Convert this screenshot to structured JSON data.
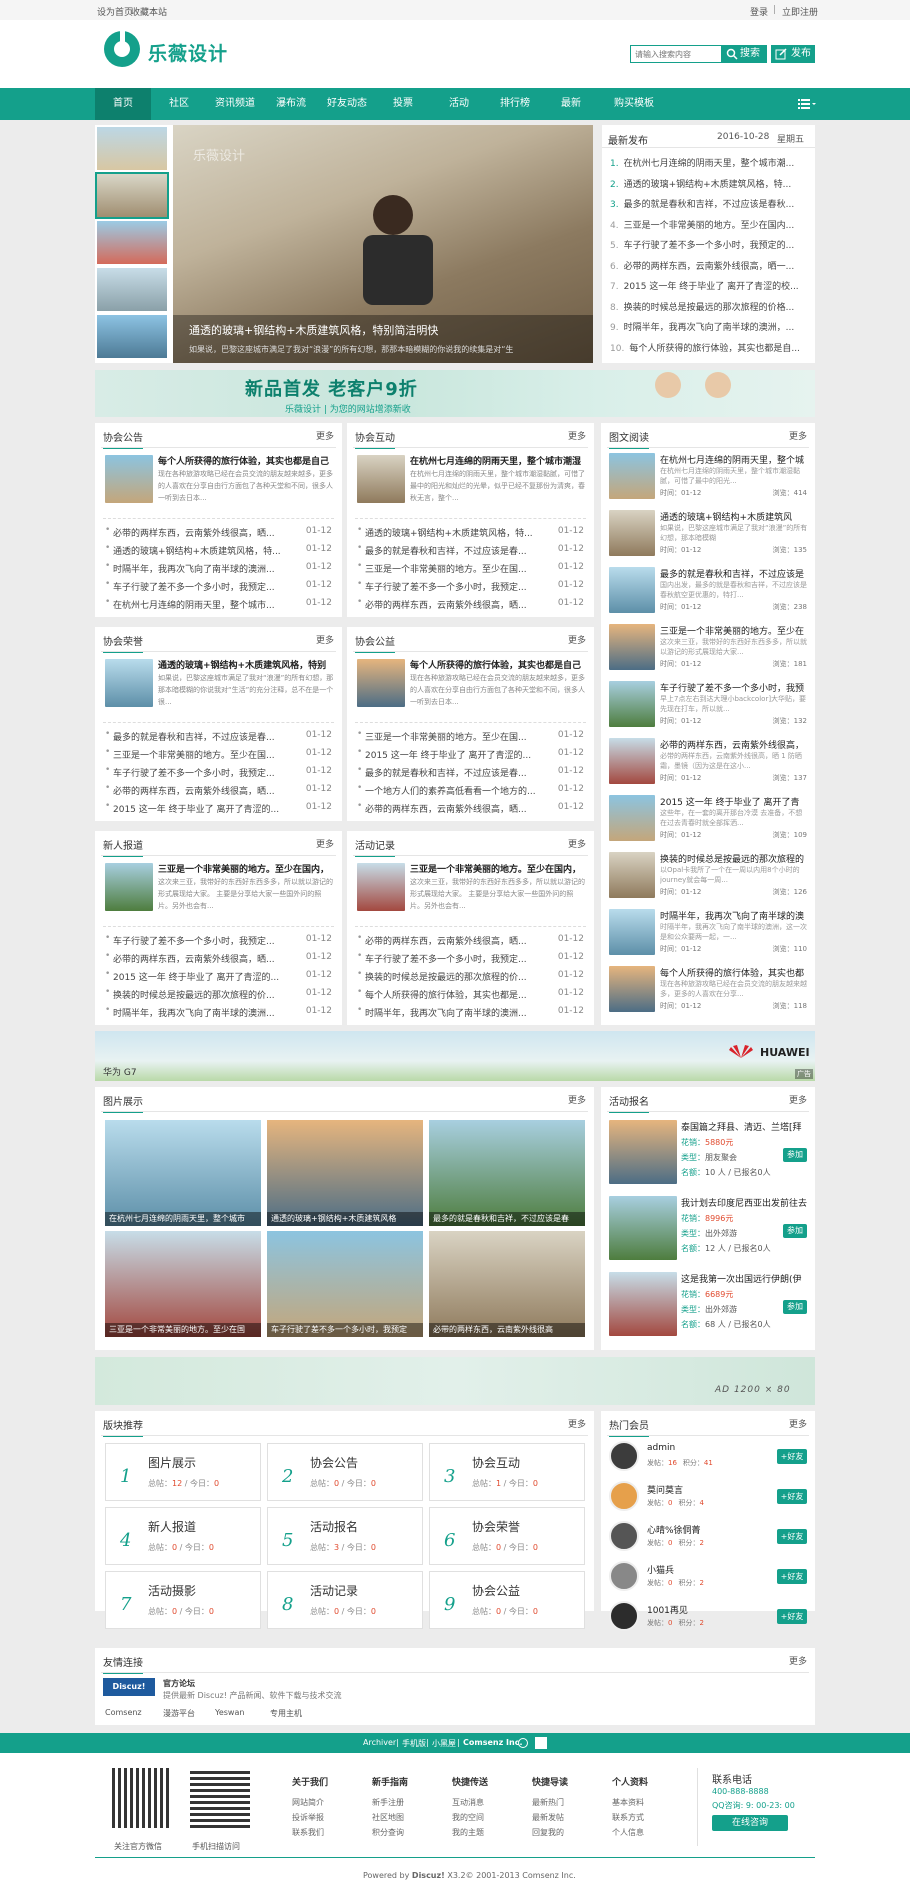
{
  "topbar": {
    "set_home": "设为首页",
    "bookmark": "收藏本站",
    "login": "登录",
    "register": "立即注册"
  },
  "header": {
    "logo_text": "乐薇设计",
    "search_placeholder": "请输入搜索内容",
    "search_btn": "搜索",
    "post_btn": "发布"
  },
  "nav": [
    "首页",
    "社区",
    "资讯频道",
    "瀑布流",
    "好友动态",
    "投票",
    "活动",
    "排行榜",
    "最新",
    "购买模板"
  ],
  "slider": {
    "caption_title": "通透的玻璃+钢结构+木质建筑风格，特别简洁明快",
    "caption_desc": "如果说，巴黎这座城市满足了我对“浪漫”的所有幻想，那那本暗模糊的你说我的续集是对“生",
    "watermark": "乐薇设计"
  },
  "latest": {
    "title": "最新发布",
    "date": "2016-10-28",
    "weekday": "星期五",
    "items": [
      {
        "n": "1.",
        "t": "在杭州七月连绵的阴雨天里，整个城市潮..."
      },
      {
        "n": "2.",
        "t": "通透的玻璃+钢结构+木质建筑风格，特..."
      },
      {
        "n": "3.",
        "t": "最多的就是春秋和吉祥，不过应该是春秋..."
      },
      {
        "n": "4.",
        "t": "三亚是一个非常美丽的地方。至少在国内..."
      },
      {
        "n": "5.",
        "t": "车子行驶了差不多一个多小时，我预定的..."
      },
      {
        "n": "6.",
        "t": "必带的两样东西，云南紫外线很高，晒一..."
      },
      {
        "n": "7.",
        "t": "2015 这一年 终于毕业了 离开了青涩的校..."
      },
      {
        "n": "8.",
        "t": "换装的时候总是按最远的那次旅程的价格..."
      },
      {
        "n": "9.",
        "t": "时隔半年，我再次飞向了南半球的澳洲，..."
      },
      {
        "n": "10.",
        "t": "每个人所获得的旅行体验，其实也都是自..."
      }
    ]
  },
  "banner1": {
    "title": "新品首发 老客户9折",
    "sub": "乐薇设计 | 为您的网站增添新收"
  },
  "forums": [
    {
      "title": "协会公告",
      "more": "更多",
      "feat_title": "每个人所获得的旅行体验，其实也都是自己",
      "feat_desc": "现在各种旅游攻略已经在会员交流的朋友越来越多，更多的人喜欢在分享自由行方面包了各种天堂和不同，很多人一听到去日本...",
      "items": [
        {
          "t": "必带的两样东西，云南紫外线很高，晒...",
          "d": "01-12"
        },
        {
          "t": "通透的玻璃+钢结构+木质建筑风格，特...",
          "d": "01-12"
        },
        {
          "t": "时隔半年，我再次飞向了南半球的澳洲...",
          "d": "01-12"
        },
        {
          "t": "车子行驶了差不多一个多小时，我预定...",
          "d": "01-12"
        },
        {
          "t": "在杭州七月连绵的阴雨天里，整个城市...",
          "d": "01-12"
        }
      ]
    },
    {
      "title": "协会互动",
      "more": "更多",
      "feat_title": "在杭州七月连绵的阴雨天里，整个城市潮湿",
      "feat_desc": "在杭州七月连绵的阴雨天里，整个城市潮湿黏腻，可惜了最中的阳光和灿烂的光晕，似乎已经不复那份为清爽，春秋无言，整个...",
      "items": [
        {
          "t": "通透的玻璃+钢结构+木质建筑风格，特...",
          "d": "01-12"
        },
        {
          "t": "最多的就是春秋和吉祥，不过应该是春...",
          "d": "01-12"
        },
        {
          "t": "三亚是一个非常美丽的地方。至少在国...",
          "d": "01-12"
        },
        {
          "t": "车子行驶了差不多一个多小时，我预定...",
          "d": "01-12"
        },
        {
          "t": "必带的两样东西，云南紫外线很高，晒...",
          "d": "01-12"
        }
      ]
    },
    {
      "title": "协会荣誉",
      "more": "更多",
      "feat_title": "通透的玻璃+钢结构+木质建筑风格，特别",
      "feat_desc": "如果说，巴黎这座城市满足了我对“浪漫”的所有幻想，那那本暗模糊的你说我对“生活”的充分注释，总不在是一个很...",
      "items": [
        {
          "t": "最多的就是春秋和吉祥，不过应该是春...",
          "d": "01-12"
        },
        {
          "t": "三亚是一个非常美丽的地方。至少在国...",
          "d": "01-12"
        },
        {
          "t": "车子行驶了差不多一个多小时，我预定...",
          "d": "01-12"
        },
        {
          "t": "必带的两样东西，云南紫外线很高，晒...",
          "d": "01-12"
        },
        {
          "t": "2015 这一年 终于毕业了 离开了青涩的...",
          "d": "01-12"
        }
      ]
    },
    {
      "title": "协会公益",
      "more": "更多",
      "feat_title": "每个人所获得的旅行体验，其实也都是自己",
      "feat_desc": "现在各种旅游攻略已经在会员交流的朋友越来越多，更多的人喜欢在分享自由行方面包了各种天堂和不同，很多人一听到去日本...",
      "items": [
        {
          "t": "三亚是一个非常美丽的地方。至少在国...",
          "d": "01-12"
        },
        {
          "t": "2015 这一年 终于毕业了 离开了青涩的...",
          "d": "01-12"
        },
        {
          "t": "最多的就是春秋和吉祥，不过应该是春...",
          "d": "01-12"
        },
        {
          "t": "一个地方人们的素养高低看看一个地方的...",
          "d": "01-12"
        },
        {
          "t": "必带的两样东西，云南紫外线很高，晒...",
          "d": "01-12"
        }
      ]
    },
    {
      "title": "新人报道",
      "more": "更多",
      "feat_title": "三亚是一个非常美丽的地方。至少在国内，",
      "feat_desc": "这次来三亚，我带好的东西好东西多多，所以就以游记的形式展现给大家。 主要是分享给大家一些国外问的照片。另外也会有...",
      "items": [
        {
          "t": "车子行驶了差不多一个多小时，我预定...",
          "d": "01-12"
        },
        {
          "t": "必带的两样东西，云南紫外线很高，晒...",
          "d": "01-12"
        },
        {
          "t": "2015 这一年 终于毕业了 离开了青涩的...",
          "d": "01-12"
        },
        {
          "t": "换装的时候总是按最远的那次旅程的价...",
          "d": "01-12"
        },
        {
          "t": "时隔半年，我再次飞向了南半球的澳洲...",
          "d": "01-12"
        }
      ]
    },
    {
      "title": "活动记录",
      "more": "更多",
      "feat_title": "三亚是一个非常美丽的地方。至少在国内，",
      "feat_desc": "这次来三亚，我带好的东西好东西多多，所以就以游记的形式展现给大家。 主要是分享给大家一些国外问的照片。另外也会有...",
      "items": [
        {
          "t": "必带的两样东西，云南紫外线很高，晒...",
          "d": "01-12"
        },
        {
          "t": "车子行驶了差不多一个多小时，我预定...",
          "d": "01-12"
        },
        {
          "t": "换装的时候总是按最远的那次旅程的价...",
          "d": "01-12"
        },
        {
          "t": "每个人所获得的旅行体验，其实也都是...",
          "d": "01-12"
        },
        {
          "t": "时隔半年，我再次飞向了南半球的澳洲...",
          "d": "01-12"
        }
      ]
    }
  ],
  "images": {
    "title": "图文阅读",
    "more": "更多",
    "items": [
      {
        "t": "在杭州七月连绵的阴雨天里，整个城",
        "desc": "在杭州七月连绵的阴雨天里，整个城市潮湿黏腻，可惜了最中的阳光...",
        "time": "时间：01-12",
        "views": "浏览：414"
      },
      {
        "t": "通透的玻璃+钢结构+木质建筑风",
        "desc": "如果说，巴黎这座城市满足了我对“浪漫”的所有幻想，那本暗模糊",
        "time": "时间：01-12",
        "views": "浏览：135"
      },
      {
        "t": "最多的就是春秋和吉祥，不过应该是",
        "desc": "国内出发，最多的就是春秋和吉祥，不过应该是春秋航空更优惠的，特打...",
        "time": "时间：01-12",
        "views": "浏览：238"
      },
      {
        "t": "三亚是一个非常美丽的地方。至少在",
        "desc": "这次来三亚，我带好的东西好东西多多，所以就以游记的形式展现给大家...",
        "time": "时间：01-12",
        "views": "浏览：181"
      },
      {
        "t": "车子行驶了差不多一个多小时，我预",
        "desc": "早上7点左右到达大理小backcolor]大华贴，要先现在打车，所以就...",
        "time": "时间：01-12",
        "views": "浏览：132"
      },
      {
        "t": "必带的两样东西，云南紫外线很高，",
        "desc": "必带的两样东西，云南紫外线很高，晒 1 防晒霜，墨镜（因为这是在这小...",
        "time": "时间：01-12",
        "views": "浏览：137"
      },
      {
        "t": "2015 这一年 终于毕业了 离开了青",
        "desc": "这些年，在一套的离开那台冷漠 去准备，不想在过去青春时就全部挥洒...",
        "time": "时间：01-12",
        "views": "浏览：109"
      },
      {
        "t": "换装的时候总是按最远的那次旅程的",
        "desc": "以Opal卡我所了一个在一周以内用8个小时的journey就会每一周...",
        "time": "时间：01-12",
        "views": "浏览：126"
      },
      {
        "t": "时隔半年，我再次飞向了南半球的澳",
        "desc": "时隔半年，我再次飞向了南半球的澳洲，这一次是和公众要两一起，一...",
        "time": "时间：01-12",
        "views": "浏览：110"
      },
      {
        "t": "每个人所获得的旅行体验，其实也都",
        "desc": "现在各种旅游攻略已经在会员交流的朋友越来越多，更多的人喜欢在分享...",
        "time": "时间：01-12",
        "views": "浏览：118"
      }
    ]
  },
  "banner2": {
    "brand": "HUAWEI",
    "model": "华为 G7",
    "ad": "广告"
  },
  "gallery": {
    "title": "图片展示",
    "more": "更多",
    "items": [
      "在杭州七月连绵的阴雨天里，整个城市",
      "通透的玻璃+钢结构+木质建筑风格",
      "最多的就是春秋和吉祥，不过应该是春",
      "三亚是一个非常美丽的地方。至少在国",
      "车子行驶了差不多一个多小时，我预定",
      "必带的两样东西，云南紫外线很高"
    ]
  },
  "events": {
    "title": "活动报名",
    "more": "更多",
    "items": [
      {
        "t": "泰国篇之拜县、清迈、兰塔[拜",
        "fee_label": "花销：",
        "fee": "5880元",
        "type_label": "类型：",
        "type": "朋友聚会",
        "count_label": "名额：",
        "count": "10 人 / 已报名0人",
        "btn": "参加"
      },
      {
        "t": "我计划去印度尼西亚出发前往去",
        "fee_label": "花销：",
        "fee": "8996元",
        "type_label": "类型：",
        "type": "出外郊游",
        "count_label": "名额：",
        "count": "12 人 / 已报名0人",
        "btn": "参加"
      },
      {
        "t": "这是我第一次出国远行伊朗(伊",
        "fee_label": "花销：",
        "fee": "6689元",
        "type_label": "类型：",
        "type": "出外郊游",
        "count_label": "名额：",
        "count": "68 人 / 已报名0人",
        "btn": "参加"
      }
    ]
  },
  "banner3": {
    "text": "AD 1200 × 80"
  },
  "boards": {
    "title": "版块推荐",
    "more": "更多",
    "items": [
      {
        "n": "1",
        "t": "图片展示",
        "s1": "总帖：",
        "a": "12",
        "s2": " / 今日：",
        "b": "0"
      },
      {
        "n": "2",
        "t": "协会公告",
        "s1": "总帖：",
        "a": "0",
        "s2": " / 今日：",
        "b": "0"
      },
      {
        "n": "3",
        "t": "协会互动",
        "s1": "总帖：",
        "a": "1",
        "s2": " / 今日：",
        "b": "0"
      },
      {
        "n": "4",
        "t": "新人报道",
        "s1": "总帖：",
        "a": "0",
        "s2": " / 今日：",
        "b": "0"
      },
      {
        "n": "5",
        "t": "活动报名",
        "s1": "总帖：",
        "a": "3",
        "s2": " / 今日：",
        "b": "0"
      },
      {
        "n": "6",
        "t": "协会荣誉",
        "s1": "总帖：",
        "a": "0",
        "s2": " / 今日：",
        "b": "0"
      },
      {
        "n": "7",
        "t": "活动摄影",
        "s1": "总帖：",
        "a": "0",
        "s2": " / 今日：",
        "b": "0"
      },
      {
        "n": "8",
        "t": "活动记录",
        "s1": "总帖：",
        "a": "0",
        "s2": " / 今日：",
        "b": "0"
      },
      {
        "n": "9",
        "t": "协会公益",
        "s1": "总帖：",
        "a": "0",
        "s2": " / 今日：",
        "b": "0"
      }
    ]
  },
  "members": {
    "title": "热门会员",
    "more": "更多",
    "items": [
      {
        "name": "admin",
        "posts_label": "发帖：",
        "posts": "16",
        "score_label": "积分：",
        "score": "41",
        "btn": "+好友"
      },
      {
        "name": "莫问莫言",
        "posts_label": "发帖：",
        "posts": "0",
        "score_label": "积分：",
        "score": "4",
        "btn": "+好友"
      },
      {
        "name": "心晴%徐侗菁",
        "posts_label": "发帖：",
        "posts": "0",
        "score_label": "积分：",
        "score": "2",
        "btn": "+好友"
      },
      {
        "name": "小猫兵",
        "posts_label": "发帖：",
        "posts": "0",
        "score_label": "积分：",
        "score": "2",
        "btn": "+好友"
      },
      {
        "name": "1001再见",
        "posts_label": "发帖：",
        "posts": "0",
        "score_label": "积分：",
        "score": "2",
        "btn": "+好友"
      }
    ]
  },
  "links": {
    "title": "友情连接",
    "more": "更多",
    "official_name": "官方论坛",
    "official_desc": "提供最新 Discuz! 产品新闻、软件下载与技术交流",
    "logo_text": "Discuz!",
    "list": [
      "Comsenz",
      "漫游平台",
      "Yeswan",
      "专用主机"
    ]
  },
  "footer_bar": {
    "archiver": "Archiver",
    "mobile": "手机版",
    "blackroom": "小黑屋",
    "company": "Comsenz Inc."
  },
  "footer": {
    "qr1": "关注官方微信",
    "qr2": "手机扫描访问",
    "cols": [
      {
        "title": "关于我们",
        "items": [
          "网站简介",
          "投诉举报",
          "联系我们"
        ]
      },
      {
        "title": "新手指南",
        "items": [
          "新手注册",
          "社区地图",
          "积分查询"
        ]
      },
      {
        "title": "快捷传送",
        "items": [
          "互动消息",
          "我的空间",
          "我的主题"
        ]
      },
      {
        "title": "快捷导读",
        "items": [
          "最新热门",
          "最新发帖",
          "回复我的"
        ]
      },
      {
        "title": "个人资料",
        "items": [
          "基本资料",
          "联系方式",
          "个人信息"
        ]
      }
    ],
    "contact_title": "联系电话",
    "phone": "400-888-8888",
    "qq": "QQ咨询: 9: 00-23: 00",
    "online_btn": "在线咨询",
    "powered_pre": "Powered by ",
    "powered_brand": "Discuz!",
    "powered_post": " X3.2© 2001-2013 Comsenz Inc."
  },
  "colors": {
    "accent": "#14a08b",
    "accent_dark": "#0d806d",
    "price": "#e04b2f"
  }
}
